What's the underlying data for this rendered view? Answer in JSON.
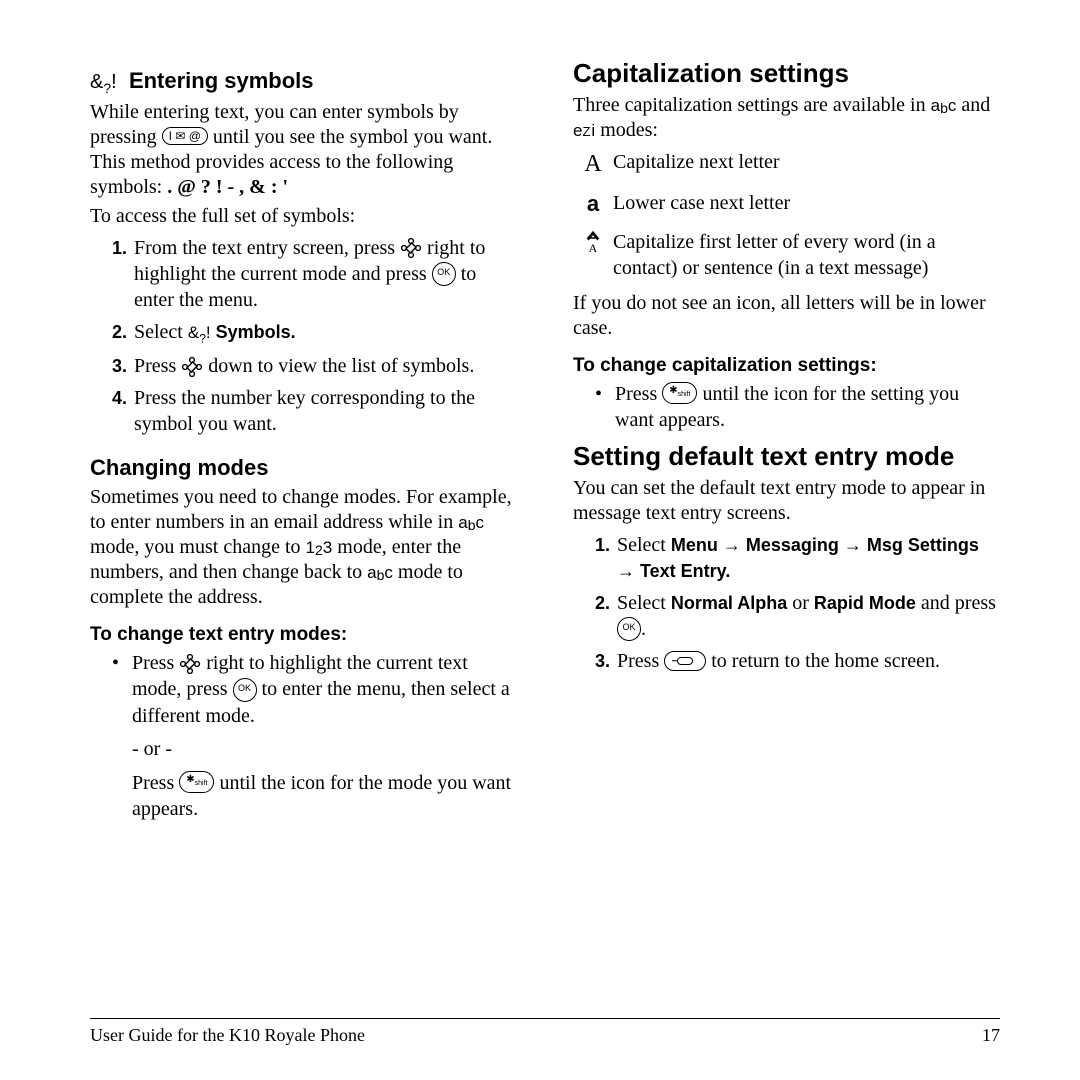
{
  "left": {
    "symbols_hdr": "Entering symbols",
    "symbols_intro_pre": "While entering text, you can enter symbols by pressing ",
    "symbols_intro_post": " until you see the symbol you want. This method provides access to the following symbols: ",
    "symbols_list": ". @ ? ! - , & : '",
    "symbols_access": "To access the full set of symbols:",
    "sym_step1_a": "From the text entry screen, press ",
    "sym_step1_b": " right to highlight the current mode and press ",
    "sym_step1_c": " to enter the menu.",
    "sym_step2_a": "Select ",
    "sym_step2_label": "Symbols",
    "sym_step3_a": "Press ",
    "sym_step3_b": " down to view the list of symbols.",
    "sym_step4": "Press the number key corresponding to the symbol you want.",
    "modes_hdr": "Changing modes",
    "modes_intro_a": "Sometimes you need to change modes. For example, to enter numbers in an email address while in ",
    "modes_intro_b": " mode, you must change to ",
    "modes_intro_c": " mode, enter the numbers, and then change back to ",
    "modes_intro_d": " mode to complete the address.",
    "modes_change_hdr": "To change text entry modes:",
    "modes_change_a": "Press ",
    "modes_change_b": " right to highlight the current text mode, press ",
    "modes_change_c": " to enter the menu, then select a different mode.",
    "or": "- or -",
    "modes_change_d": "Press ",
    "modes_change_e": " until the icon for the mode you want appears."
  },
  "right": {
    "cap_hdr": "Capitalization settings",
    "cap_intro_a": "Three capitalization settings are available in ",
    "cap_intro_b": " and ",
    "cap_intro_c": " modes:",
    "cap_item1": "Capitalize next letter",
    "cap_item2": "Lower case next letter",
    "cap_item3": "Capitalize first letter of every word (in a contact) or sentence (in a text message)",
    "cap_noicon": "If you do not see an icon, all letters will be in lower case.",
    "cap_change_hdr": "To change capitalization settings:",
    "cap_change_a": "Press ",
    "cap_change_b": " until the icon for the setting you want appears.",
    "def_hdr": "Setting default text entry mode",
    "def_intro": "You can set the default text entry mode to appear in message text entry screens.",
    "def_step1_a": "Select ",
    "def_step1_path": "Menu → Messaging → Msg Settings → Text Entry",
    "def_step2_a": "Select ",
    "def_step2_opt1": "Normal Alpha",
    "def_step2_mid": " or ",
    "def_step2_opt2": "Rapid Mode",
    "def_step2_b": " and press ",
    "def_step3_a": "Press ",
    "def_step3_b": " to return to the home screen."
  },
  "footer": {
    "left": "User Guide for the K10 Royale Phone",
    "right": "17"
  }
}
